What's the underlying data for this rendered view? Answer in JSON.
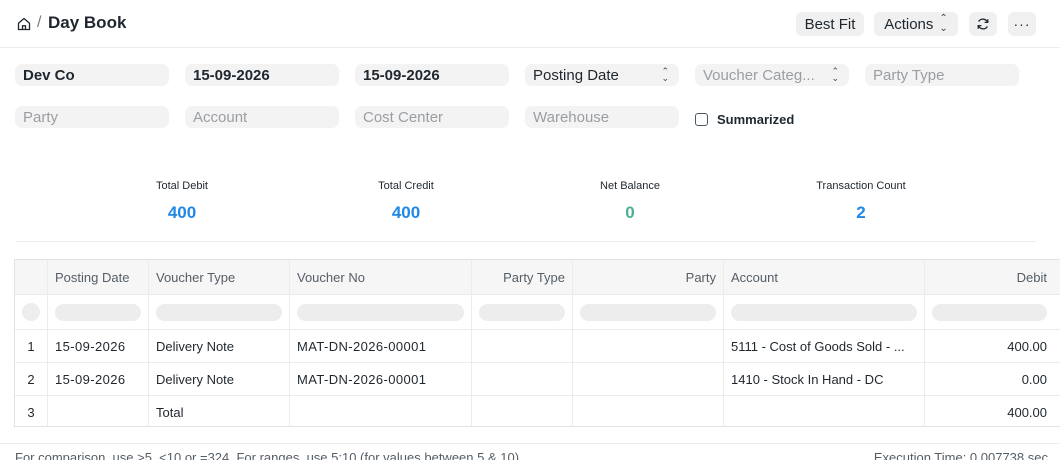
{
  "breadcrumb": {
    "separator": "/",
    "title": "Day Book"
  },
  "toolbar": {
    "best_fit_label": "Best Fit",
    "actions_label": "Actions",
    "more_label": "···"
  },
  "filters": {
    "company": "Dev Co",
    "from_date": "15-09-2026",
    "to_date": "15-09-2026",
    "date_type": "Posting Date",
    "voucher_category_placeholder": "Voucher Categ...",
    "party_type_placeholder": "Party Type",
    "party_placeholder": "Party",
    "account_placeholder": "Account",
    "cost_center_placeholder": "Cost Center",
    "warehouse_placeholder": "Warehouse",
    "summarized_label": "Summarized"
  },
  "summary": [
    {
      "label": "Total Debit",
      "value": "400",
      "color": "#1e88e5"
    },
    {
      "label": "Total Credit",
      "value": "400",
      "color": "#1e88e5"
    },
    {
      "label": "Net Balance",
      "value": "0",
      "color": "#4caf93"
    },
    {
      "label": "Transaction Count",
      "value": "2",
      "color": "#1e88e5"
    }
  ],
  "table": {
    "columns": [
      "",
      "Posting Date",
      "Voucher Type",
      "Voucher No",
      "Party Type",
      "Party",
      "Account",
      "Debit"
    ],
    "rows": [
      {
        "idx": "1",
        "posting_date": "15-09-2026",
        "voucher_type": "Delivery Note",
        "voucher_no": "MAT-DN-2026-00001",
        "party_type": "",
        "party": "",
        "account": "5111 - Cost of Goods Sold - ...",
        "debit": "400.00"
      },
      {
        "idx": "2",
        "posting_date": "15-09-2026",
        "voucher_type": "Delivery Note",
        "voucher_no": "MAT-DN-2026-00001",
        "party_type": "",
        "party": "",
        "account": "1410 - Stock In Hand - DC",
        "debit": "0.00"
      },
      {
        "idx": "3",
        "posting_date": "",
        "voucher_type": "Total",
        "voucher_no": "",
        "party_type": "",
        "party": "",
        "account": "",
        "debit": "400.00"
      }
    ]
  },
  "footer": {
    "hint": "For comparison, use >5, <10 or =324. For ranges, use 5:10 (for values between 5 & 10).",
    "execution_time": "Execution Time: 0.007738 sec"
  }
}
